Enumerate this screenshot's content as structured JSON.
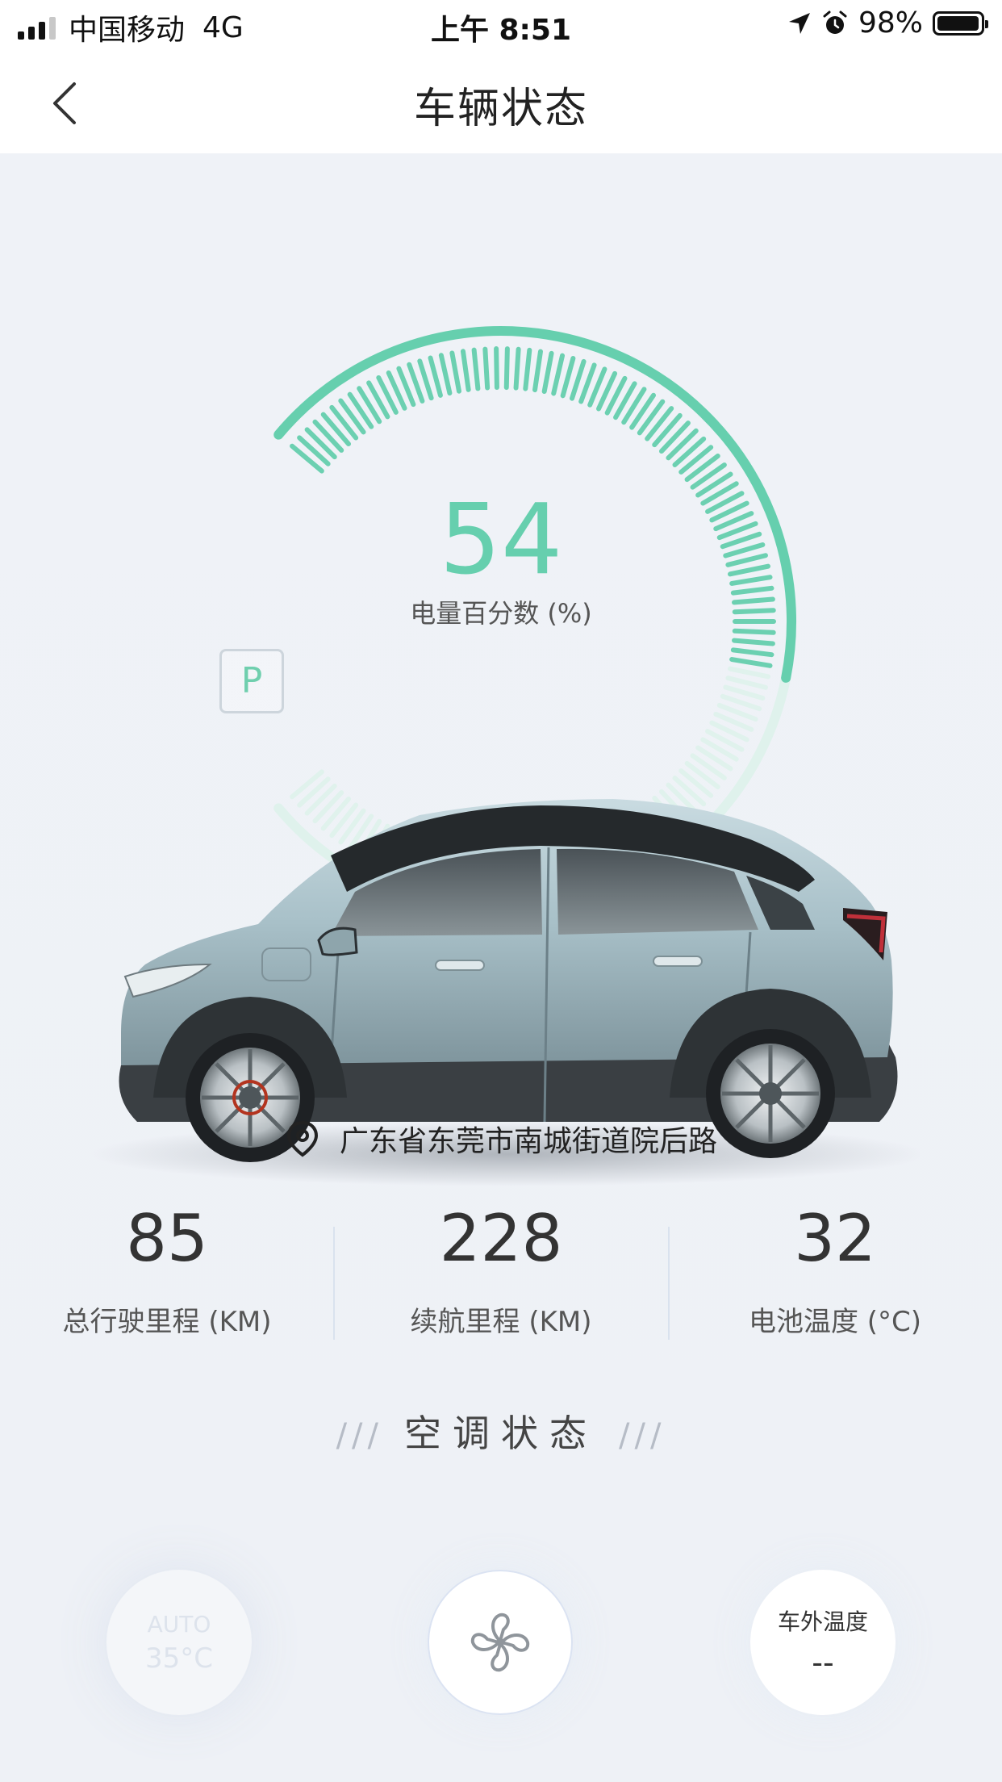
{
  "status_bar": {
    "carrier": "中国移动",
    "network": "4G",
    "time": "上午 8:51",
    "battery_percent": "98%",
    "battery_level": 0.98
  },
  "header": {
    "title": "车辆状态"
  },
  "gauge": {
    "percent": "54",
    "label": "电量百分数 (%)",
    "level": 54,
    "accent_color": "#66cfae",
    "track_color": "#dff2ec"
  },
  "gear": "P",
  "location": {
    "address": "广东省东莞市南城街道院后路"
  },
  "stats": [
    {
      "value": "85",
      "label": "总行驶里程 (KM)"
    },
    {
      "value": "228",
      "label": "续航里程 (KM)"
    },
    {
      "value": "32",
      "label": "电池温度 (°C)"
    }
  ],
  "ac": {
    "section_title": "空调状态",
    "slashes": "///",
    "auto_label": "AUTO",
    "auto_temp": "35°C",
    "outside_label": "车外温度",
    "outside_value": "--"
  },
  "icons": {
    "back": "chevron-left-icon",
    "location": "location-pin-icon",
    "fan": "fan-icon"
  }
}
